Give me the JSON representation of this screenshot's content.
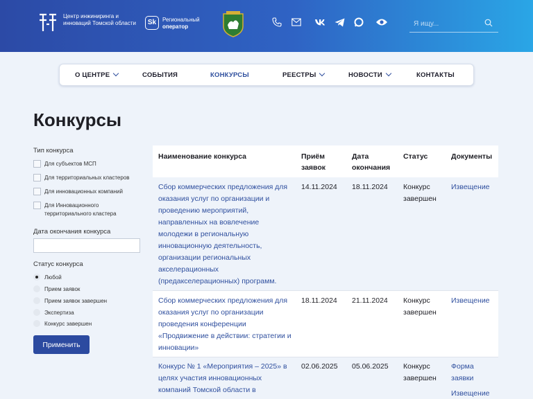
{
  "header": {
    "org_name": "Центр инжиниринга и инноваций Томской области",
    "operator_badge": "Sk",
    "operator_line1": "Региональный",
    "operator_line2": "оператор",
    "search_placeholder": "Я ищу..."
  },
  "nav": {
    "items": [
      {
        "label": "О ЦЕНТРЕ"
      },
      {
        "label": "СОБЫТИЯ"
      },
      {
        "label": "КОНКУРСЫ"
      },
      {
        "label": "РЕЕСТРЫ"
      },
      {
        "label": "НОВОСТИ"
      },
      {
        "label": "КОНТАКТЫ"
      }
    ]
  },
  "page_title": "Конкурсы",
  "filters": {
    "type_label": "Тип конкурса",
    "types": [
      "Для субъектов МСП",
      "Для территориальных кластеров",
      "Для инновационных компаний",
      "Для Инновационного территориального кластера"
    ],
    "date_label": "Дата окончания конкурса",
    "status_label": "Статус конкурса",
    "statuses": [
      "Любой",
      "Прием заявок",
      "Прием заявок завершен",
      "Экспертиза",
      "Конкурс завершен"
    ],
    "selected_status": "Любой",
    "apply_label": "Применить"
  },
  "table": {
    "headers": {
      "name": "Наименование конкурса",
      "start": "Приём заявок",
      "end": "Дата окончания",
      "status": "Статус",
      "docs": "Документы"
    },
    "rows": [
      {
        "name": "Сбор коммерческих предложения для оказания услуг по организации и проведению мероприятий, направленных на вовлечение молодежи в региональную инновационную деятельность, организации региональных акселерационных (предакселерационных) программ.",
        "start": "14.11.2024",
        "end": "18.11.2024",
        "status": "Конкурс завершен",
        "doc1": "Извещение",
        "doc2": ""
      },
      {
        "name": "Сбор коммерческих предложения для оказания услуг по организации проведения конференции «Продвижение в действии: стратегии и инновации»",
        "start": "18.11.2024",
        "end": "21.11.2024",
        "status": "Конкурс завершен",
        "doc1": "Извещение",
        "doc2": ""
      },
      {
        "name": "Конкурс № 1 «Мероприятия – 2025» в целях участия инновационных компаний Томской области в",
        "start": "02.06.2025",
        "end": "05.06.2025",
        "status": "Конкурс завершен",
        "doc1": "Форма заявки",
        "doc2": "Извещение"
      }
    ]
  },
  "colors": {
    "accent": "#2f4f9e",
    "header_start": "#2c4aa6",
    "header_end": "#2aa6e6",
    "button": "#2c4aa0"
  }
}
